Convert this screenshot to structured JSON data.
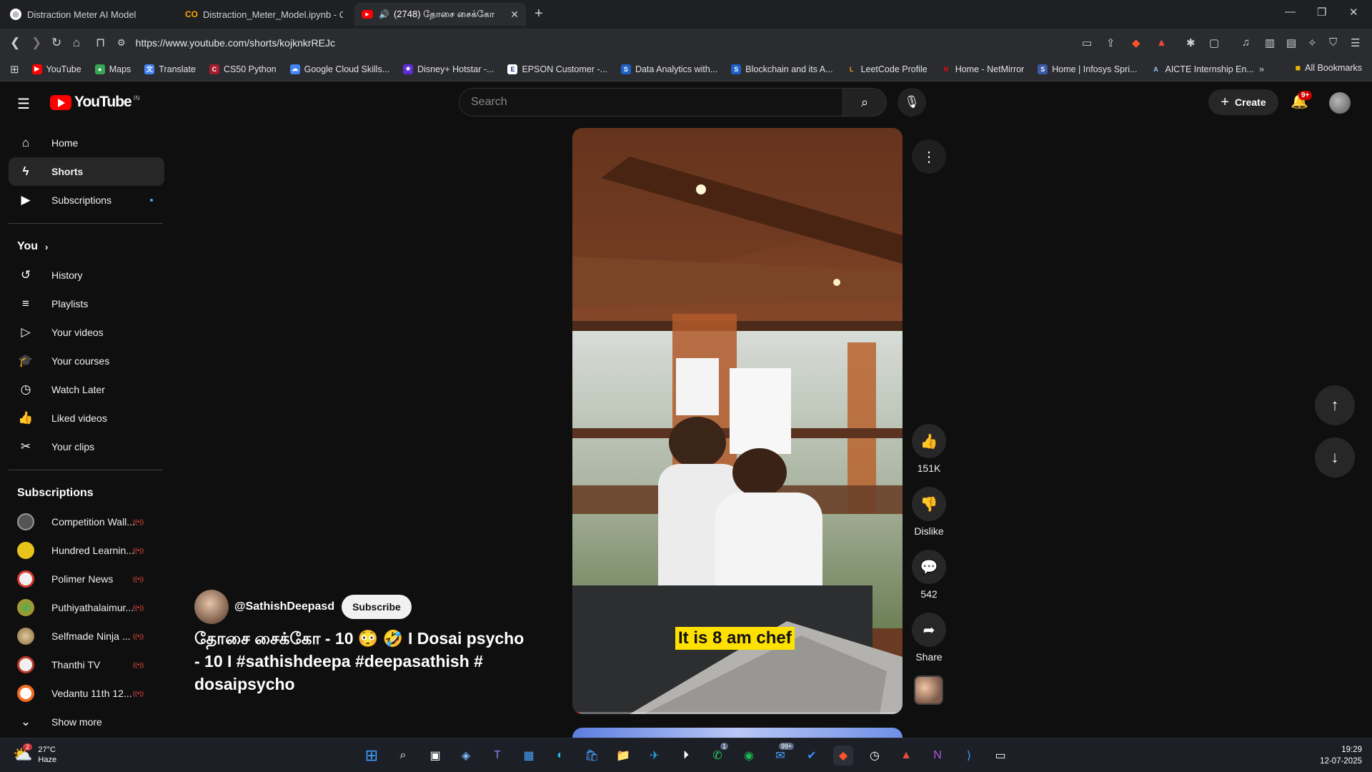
{
  "browser": {
    "tabs": [
      {
        "label": "Distraction Meter AI Model",
        "active": false
      },
      {
        "label": "Distraction_Meter_Model.ipynb - Col",
        "active": false
      },
      {
        "label": "(2748) தோசை சைக்கோ",
        "active": true
      }
    ],
    "url": "https://www.youtube.com/shorts/kojknkrREJc",
    "bookmarks": [
      "YouTube",
      "Maps",
      "Translate",
      "CS50 Python",
      "Google Cloud Skills...",
      "Disney+ Hotstar -...",
      "EPSON Customer -...",
      "Data Analytics with...",
      "Blockchain and its A...",
      "LeetCode Profile",
      "Home - NetMirror",
      "Home | Infosys Spri...",
      "AICTE Internship En..."
    ],
    "all_bookmarks": "All Bookmarks"
  },
  "youtube": {
    "logo_text": "YouTube",
    "country_code": "IN",
    "search_placeholder": "Search",
    "create_label": "Create",
    "notif_badge": "9+",
    "sidebar": {
      "main": [
        {
          "label": "Home",
          "icon": "home-icon"
        },
        {
          "label": "Shorts",
          "icon": "shorts-icon"
        },
        {
          "label": "Subscriptions",
          "icon": "subscriptions-icon"
        }
      ],
      "you_heading": "You",
      "you_items": [
        {
          "label": "History",
          "icon": "history-icon"
        },
        {
          "label": "Playlists",
          "icon": "playlists-icon"
        },
        {
          "label": "Your videos",
          "icon": "your-videos-icon"
        },
        {
          "label": "Your courses",
          "icon": "courses-icon"
        },
        {
          "label": "Watch Later",
          "icon": "clock-icon"
        },
        {
          "label": "Liked videos",
          "icon": "like-icon"
        },
        {
          "label": "Your clips",
          "icon": "scissors-icon"
        }
      ],
      "subs_heading": "Subscriptions",
      "subscriptions": [
        {
          "label": "Competition Wall...",
          "color": "#555555"
        },
        {
          "label": "Hundred Learnin...",
          "color": "#e8c31a"
        },
        {
          "label": "Polimer News",
          "color": "#d73a2f"
        },
        {
          "label": "Puthiyathalaimur...",
          "color": "#d98a1f"
        },
        {
          "label": "Selfmade Ninja ...",
          "color": "#8a6a3a"
        },
        {
          "label": "Thanthi TV",
          "color": "#c0392b"
        },
        {
          "label": "Vedantu 11th 12...",
          "color": "#f36b21"
        }
      ],
      "show_more": "Show more"
    },
    "short": {
      "caption": "It is 8 am chef",
      "channel": "@SathishDeepasd",
      "subscribe_label": "Subscribe",
      "title": "தோசை சைக்கோ - 10 😳 🤣 I Dosai psycho - 10 I #sathishdeepa #deepasathish # dosaipsycho",
      "progress": 0.02,
      "actions": {
        "likes": "151K",
        "dislike_label": "Dislike",
        "comments": "542",
        "share_label": "Share"
      }
    }
  },
  "taskbar": {
    "temp": "27°C",
    "weather": "Haze",
    "weather_badge": "2",
    "time": "19:29",
    "date": "12-07-2025",
    "whatsapp_badge": "1",
    "mail_badge": "99+"
  },
  "colors": {
    "accent_red": "#ff0000",
    "caption_bg": "#ffe100",
    "bg": "#0f0f0f"
  }
}
